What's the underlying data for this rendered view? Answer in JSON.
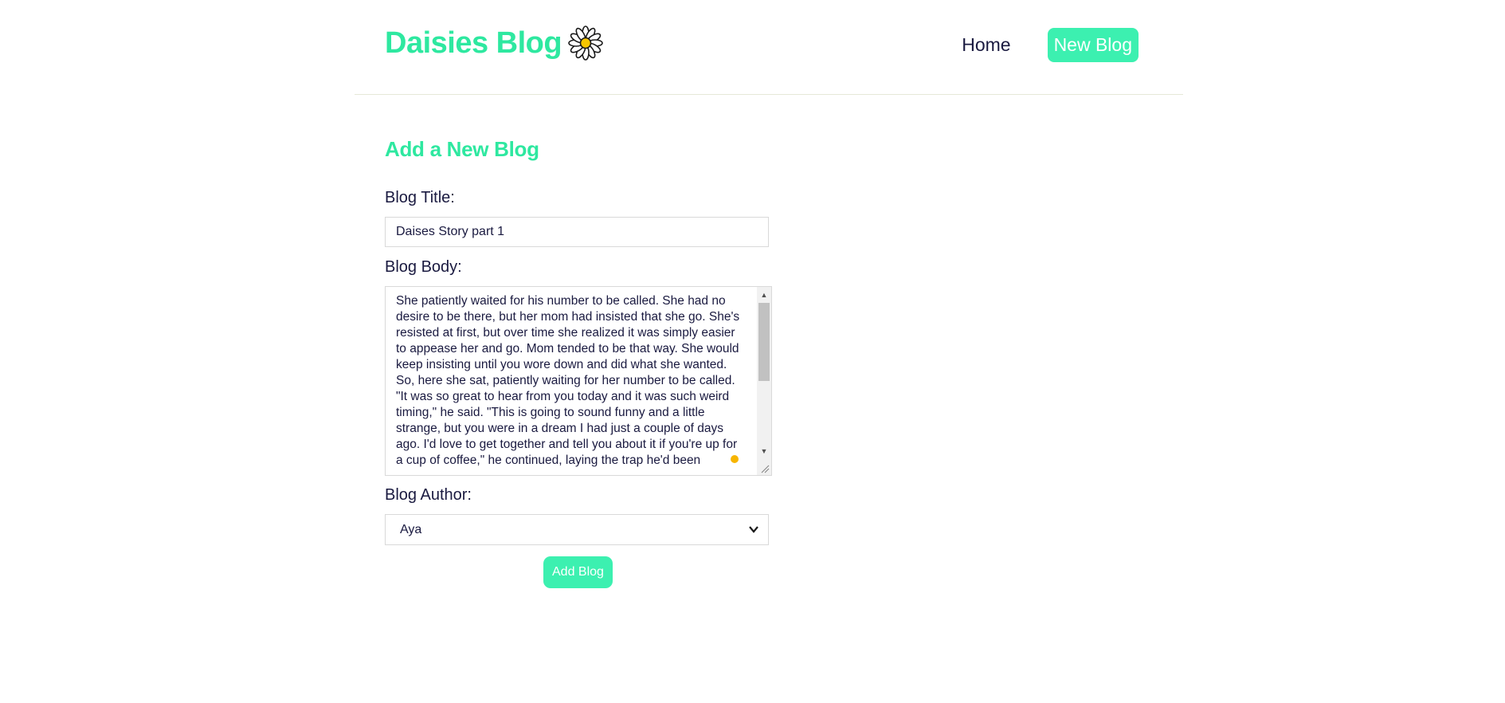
{
  "navbar": {
    "brand_title": "Daisies Blog",
    "brand_icon": "daisy-icon",
    "links": [
      {
        "label": "Home",
        "active": false
      },
      {
        "label": "New Blog",
        "active": true
      }
    ]
  },
  "form": {
    "heading": "Add a New Blog",
    "title_label": "Blog Title:",
    "title_value": "Daises Story part 1",
    "body_label": "Blog Body:",
    "body_value": "She patiently waited for his number to be called. She had no desire to be there, but her mom had insisted that she go. She's resisted at first, but over time she realized it was simply easier to appease her and go. Mom tended to be that way. She would keep insisting until you wore down and did what she wanted. So, here she sat, patiently waiting for her number to be called.\n\"It was so great to hear from you today and it was such weird timing,\" he said. \"This is going to sound funny and a little strange, but you were in a dream I had just a couple of days ago. I'd love to get together and tell you about it if you're up for a cup of coffee,\" he continued, laying the trap he'd been",
    "author_label": "Blog Author:",
    "author_value": "Aya",
    "submit_label": "Add Blog"
  },
  "colors": {
    "accent": "#2ee8a0",
    "button_bg": "#3cf0b0",
    "text": "#1a1a40"
  }
}
